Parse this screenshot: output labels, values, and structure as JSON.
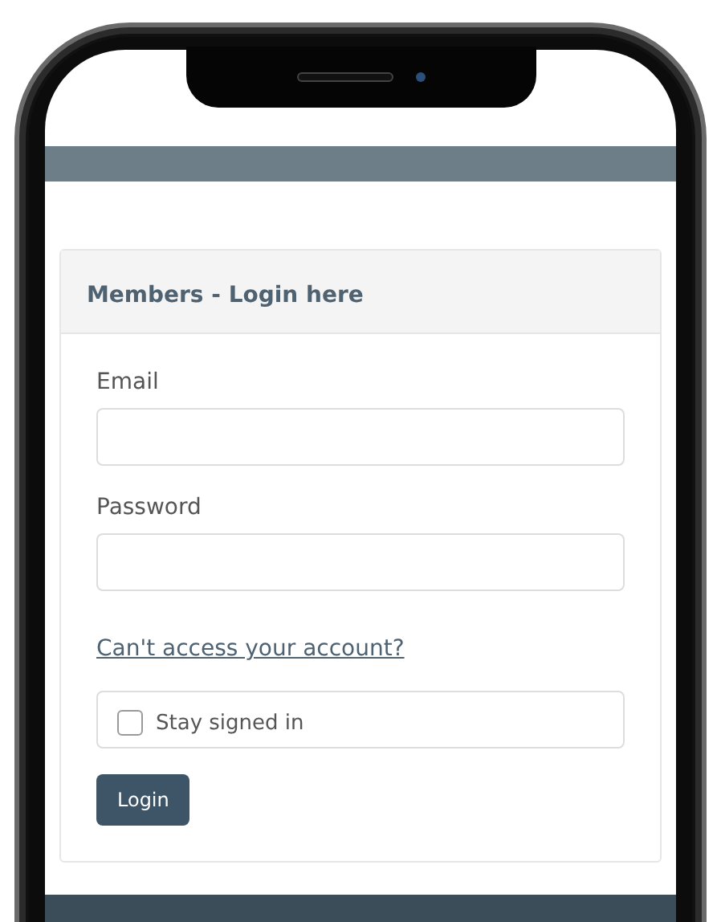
{
  "login_panel": {
    "title": "Members - Login here",
    "fields": [
      {
        "label": "Email"
      },
      {
        "label": "Password"
      }
    ],
    "link": "Can't access your account?",
    "remember": {
      "label": "Stay signed in",
      "checked": false
    },
    "button": "Login"
  }
}
